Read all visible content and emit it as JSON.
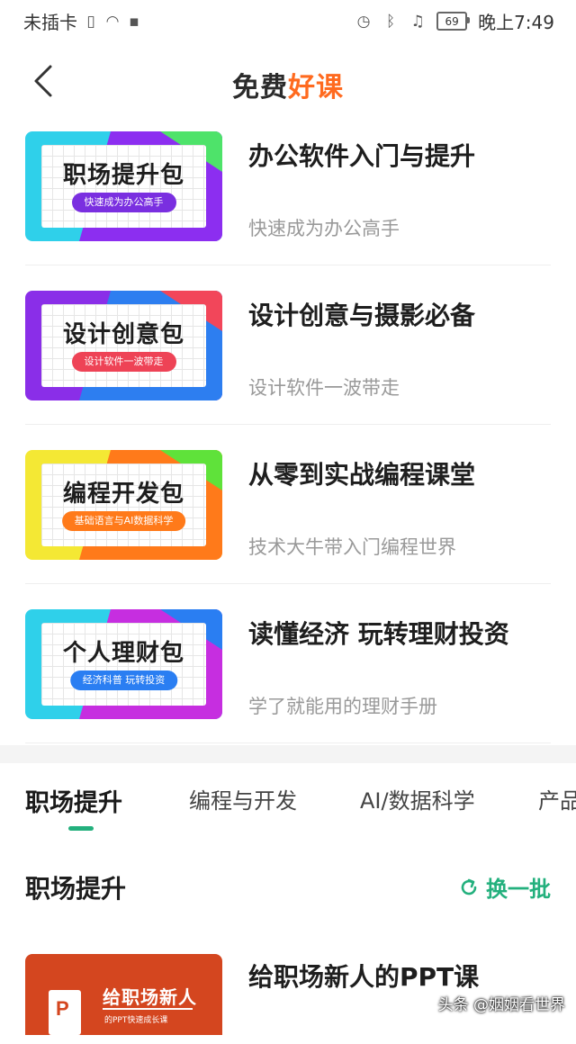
{
  "status_bar": {
    "carrier": "未插卡",
    "battery": "69",
    "time": "晚上7:49"
  },
  "nav": {
    "title_part1": "免费",
    "title_part2": "好课"
  },
  "bundles": [
    {
      "cover_title": "职场提升包",
      "cover_tag": "快速成为办公高手",
      "title": "办公软件入门与提升",
      "subtitle": "快速成为办公高手",
      "colors": {
        "a": "#2fd0ea",
        "b": "#8c2ef0",
        "c": "#4ee36a",
        "pill": "#7a2fe0"
      }
    },
    {
      "cover_title": "设计创意包",
      "cover_tag": "设计软件一波带走",
      "title": "设计创意与摄影必备",
      "subtitle": "设计软件一波带走",
      "colors": {
        "a": "#8a2ee8",
        "b": "#2d7ef0",
        "c": "#f2465a",
        "pill": "#ee4356"
      }
    },
    {
      "cover_title": "编程开发包",
      "cover_tag": "基础语言与AI数据科学",
      "title": "从零到实战编程课堂",
      "subtitle": "技术大牛带入门编程世界",
      "colors": {
        "a": "#f4e834",
        "b": "#ff7a1a",
        "c": "#5fe23a",
        "pill": "#ff7a1a"
      }
    },
    {
      "cover_title": "个人理财包",
      "cover_tag": "经济科普 玩转投资",
      "title": "读懂经济 玩转理财投资",
      "subtitle": "学了就能用的理财手册",
      "colors": {
        "a": "#2fd0ea",
        "b": "#c62ee0",
        "c": "#2a7ef2",
        "pill": "#2a7ef2"
      }
    }
  ],
  "tabs": [
    {
      "label": "职场提升"
    },
    {
      "label": "编程与开发"
    },
    {
      "label": "AI/数据科学"
    },
    {
      "label": "产品"
    }
  ],
  "section": {
    "title": "职场提升",
    "refresh_label": "换一批"
  },
  "course": {
    "thumb_title": "给职场新人",
    "thumb_sub": "的PPT快速成长课",
    "title": "给职场新人的PPT课"
  },
  "watermark": "头条 @姻姻看世界"
}
